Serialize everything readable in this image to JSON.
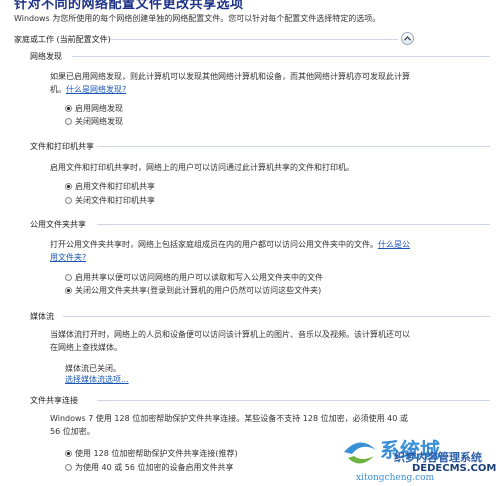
{
  "title": "针对不同的网络配置文件更改共享选项",
  "intro": "Windows 为您所使用的每个网络创建单独的网络配置文件。您可以针对每个配置文件选择特定的选项。",
  "profile": {
    "label": "家庭或工作 (当前配置文件)"
  },
  "sections": {
    "discovery": {
      "heading": "网络发现",
      "desc": "如果已启用网络发现，则此计算机可以发现其他网络计算机和设备，而其他网络计算机亦可发现此计算机。",
      "link": "什么是网络发现?",
      "options": [
        "启用网络发现",
        "关闭网络发现"
      ]
    },
    "fileprint": {
      "heading": "文件和打印机共享",
      "desc": "启用文件和打印机共享时，网络上的用户可以访问通过此计算机共享的文件和打印机。",
      "options": [
        "启用文件和打印机共享",
        "关闭文件和打印机共享"
      ]
    },
    "public": {
      "heading": "公用文件夹共享",
      "desc": "打开公用文件夹共享时，网络上包括家庭组成员在内的用户都可以访问公用文件夹中的文件。",
      "link_part1": "什么",
      "link_part2": "是公用文件夹?",
      "options": [
        "启用共享以便可以访问网络的用户可以读取和写入公用文件夹中的文件",
        "关闭公用文件夹共享(登录到此计算机的用户仍然可以访问这些文件夹)"
      ]
    },
    "media": {
      "heading": "媒体流",
      "desc": "当媒体流打开时，网络上的人员和设备便可以访问该计算机上的图片、音乐以及视频。该计算机还可以在网络上查找媒体。",
      "status": "媒体流已关闭。",
      "link": "选择媒体流选项..."
    },
    "fileshare": {
      "heading": "文件共享连接",
      "desc": "Windows 7 使用 128 位加密帮助保护文件共享连接。某些设备不支持 128 位加密，必须使用 40 或 56 位加密。",
      "options": [
        "使用 128 位加密帮助保护文件共享连接(推荐)",
        "为使用 40 或 56 位加密的设备启用文件共享"
      ]
    }
  },
  "watermark": {
    "brand": "系统城",
    "line2": "织梦内容管理系统",
    "line3": "DEDECMS.COM",
    "url": "xitongcheng.com"
  },
  "colors": {
    "title": "#1e3287",
    "link": "#1a57b5",
    "rule": "#ccd6e6"
  }
}
